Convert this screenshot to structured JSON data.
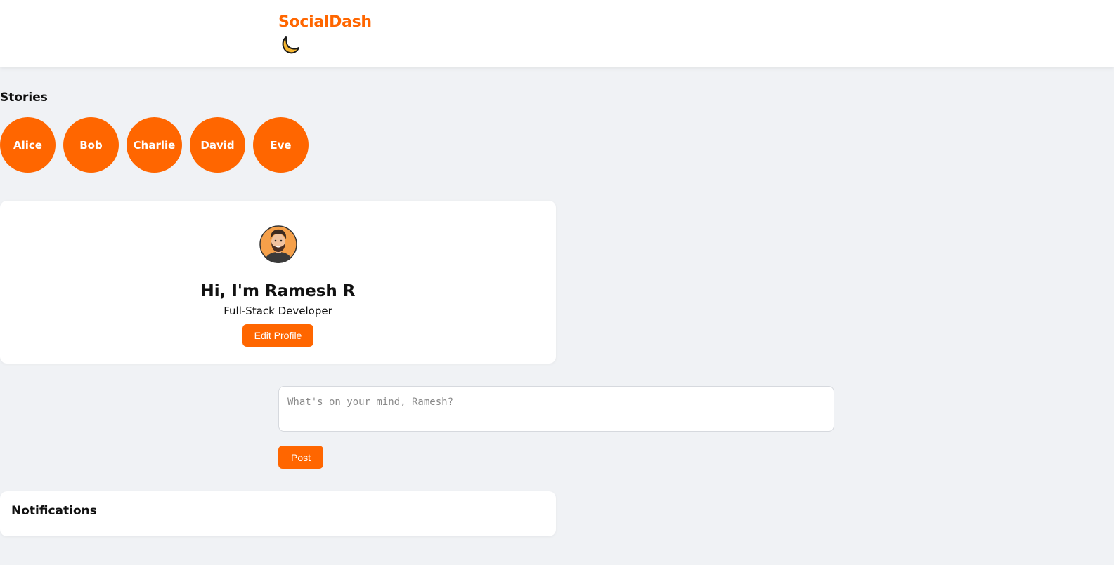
{
  "header": {
    "brand": "SocialDash",
    "theme_toggle_icon": "moon-icon"
  },
  "stories": {
    "title": "Stories",
    "items": [
      {
        "label": "Alice"
      },
      {
        "label": "Bob"
      },
      {
        "label": "Charlie"
      },
      {
        "label": "David"
      },
      {
        "label": "Eve"
      }
    ]
  },
  "profile": {
    "avatar_icon": "avatar-illustration",
    "greeting": "Hi, I'm Ramesh R",
    "role": "Full-Stack Developer",
    "edit_label": "Edit Profile"
  },
  "composer": {
    "placeholder": "What's on your mind, Ramesh?",
    "value": "",
    "post_label": "Post"
  },
  "notifications": {
    "title": "Notifications"
  },
  "colors": {
    "accent": "#ff6600",
    "background": "#f0f2f5",
    "card": "#ffffff"
  }
}
